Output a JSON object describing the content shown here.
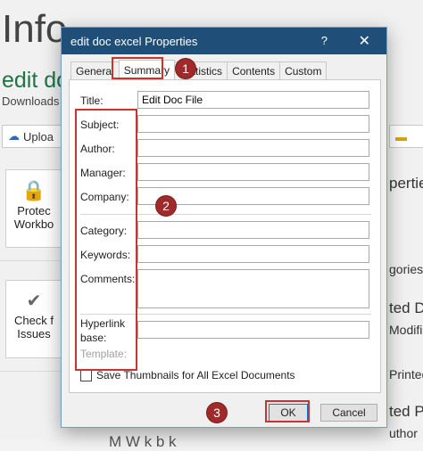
{
  "background": {
    "page_title": "Info",
    "doc_name": "edit do",
    "path": "Downloads",
    "upload_label": "Uploa",
    "protect_label_1": "Protec",
    "protect_label_2": "Workbo",
    "check_label_1": "Check f",
    "check_label_2": "Issues",
    "right_1": "perties",
    "right_2": "gories",
    "right_3": "ted Da",
    "right_4": "Modifie",
    "right_5": "Printed",
    "right_6": "ted Pe",
    "right_7": "uthor",
    "bottom_text": "M      W  k  b    k"
  },
  "dialog": {
    "title": "edit doc excel Properties",
    "help_glyph": "?",
    "close_glyph": "✕",
    "tabs": [
      {
        "label": "General"
      },
      {
        "label": "Summary"
      },
      {
        "label": "Statistics"
      },
      {
        "label": "Contents"
      },
      {
        "label": "Custom"
      }
    ],
    "fields": {
      "title": {
        "label": "Title:",
        "value": "Edit Doc File"
      },
      "subject": {
        "label": "Subject:",
        "value": ""
      },
      "author": {
        "label": "Author:",
        "value": ""
      },
      "manager": {
        "label": "Manager:",
        "value": ""
      },
      "company": {
        "label": "Company:",
        "value": ""
      },
      "category": {
        "label": "Category:",
        "value": ""
      },
      "keywords": {
        "label": "Keywords:",
        "value": ""
      },
      "comments": {
        "label": "Comments:",
        "value": ""
      },
      "hyperlink_1": "Hyperlink",
      "hyperlink_2": "base:",
      "hyperlink_value": "",
      "template": "Template:"
    },
    "thumbnail_label": "Save Thumbnails for All Excel Documents",
    "ok_label": "OK",
    "cancel_label": "Cancel"
  },
  "callouts": [
    "1",
    "2",
    "3"
  ],
  "colors": {
    "titlebar": "#1f4e79",
    "highlight_red": "#d03030",
    "badge": "#a02a2a",
    "excel_green": "#217346"
  }
}
